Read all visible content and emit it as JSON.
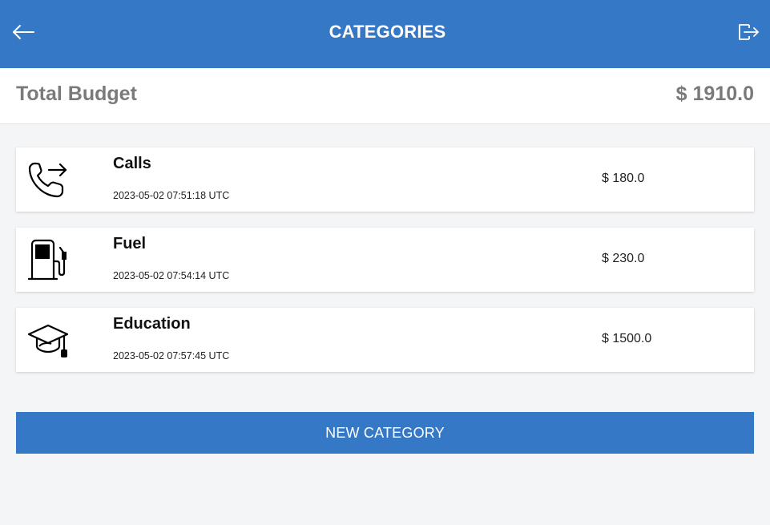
{
  "app_bar": {
    "title": "CATEGORIES",
    "back_icon": "arrow-left-icon",
    "logout_icon": "logout-icon",
    "color": "#3478c6"
  },
  "budget": {
    "label": "Total Budget",
    "value": "$ 1910.0"
  },
  "categories": [
    {
      "name": "Calls",
      "date": "2023-05-02 07:51:18 UTC",
      "amount": "$ 180.0",
      "icon": "phone-forward-icon"
    },
    {
      "name": "Fuel",
      "date": "2023-05-02 07:54:14 UTC",
      "amount": "$ 230.0",
      "icon": "fuel-pump-icon"
    },
    {
      "name": "Education",
      "date": "2023-05-02 07:57:45 UTC",
      "amount": "$ 1500.0",
      "icon": "graduation-cap-icon"
    }
  ],
  "new_category_button": "NEW CATEGORY"
}
